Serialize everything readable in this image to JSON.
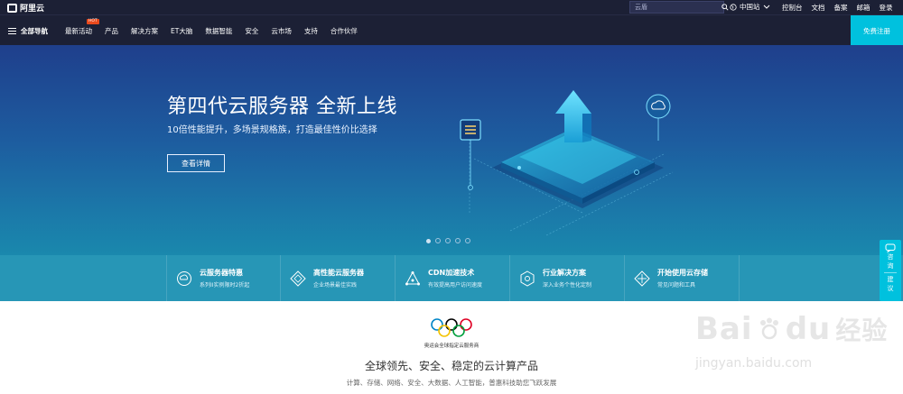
{
  "brand": {
    "name": "阿里云"
  },
  "topbar": {
    "search_placeholder": "云盾",
    "region": "中国站",
    "links": [
      "控制台",
      "文档",
      "备案",
      "邮箱",
      "登录"
    ]
  },
  "nav": {
    "all_label": "全部导航",
    "items": [
      {
        "label": "最新活动",
        "badge": "HOT"
      },
      {
        "label": "产品"
      },
      {
        "label": "解决方案"
      },
      {
        "label": "ET大脑"
      },
      {
        "label": "数据智能"
      },
      {
        "label": "安全"
      },
      {
        "label": "云市场"
      },
      {
        "label": "支持"
      },
      {
        "label": "合作伙伴"
      }
    ],
    "register_label": "免费注册"
  },
  "hero": {
    "title": "第四代云服务器 全新上线",
    "subtitle": "10倍性能提升，多场景规格族，打造最佳性价比选择",
    "button_label": "查看详情",
    "slides_total": 5,
    "slide_active": 1
  },
  "features": [
    {
      "title": "云服务器特惠",
      "desc": "系列II实例限时2折起",
      "icon": "cloud-server-icon"
    },
    {
      "title": "高性能云服务器",
      "desc": "企业场景最佳实践",
      "icon": "diamond-icon"
    },
    {
      "title": "CDN加速技术",
      "desc": "有效提高用户访问速度",
      "icon": "network-icon"
    },
    {
      "title": "行业解决方案",
      "desc": "深入业务个性化定制",
      "icon": "solution-icon"
    },
    {
      "title": "开始使用云存储",
      "desc": "常见问题和工具",
      "icon": "storage-icon"
    }
  ],
  "float": {
    "consult": "咨询",
    "suggest": "建议"
  },
  "lower": {
    "olympic_caption": "奥运会全球指定云服务商",
    "title": "全球领先、安全、稳定的云计算产品",
    "subtitle": "计算、存储、网络、安全、大数据、人工智能，普惠科技助您飞跃发展"
  },
  "watermark": {
    "big": "Bai",
    "du": "du",
    "jy": "经验",
    "url": "jingyan.baidu.com"
  },
  "colors": {
    "nav_bg": "#1c2035",
    "accent": "#00c1de",
    "hot": "#e8491d",
    "strip": "#2796b6"
  }
}
